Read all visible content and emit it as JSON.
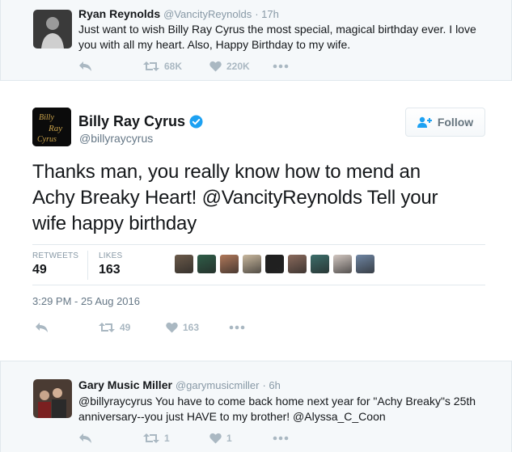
{
  "reply_context": {
    "name": "Ryan Reynolds",
    "handle": "@VancityReynolds",
    "time": "· 17h",
    "text_line1": "Just want to wish Billy Ray Cyrus the most special, magical birthday ever. I love",
    "text_line2": "you with all my heart. Also, Happy Birthday to my wife.",
    "retweets": "68K",
    "likes": "220K"
  },
  "main_tweet": {
    "name": "Billy Ray Cyrus",
    "handle": "@billyraycyrus",
    "avatar_text": [
      "Billy",
      "Ray",
      "Cyrus"
    ],
    "follow_label": "Follow",
    "text_line1": "Thanks man, you really know how to mend an",
    "text_line2": "Achy Breaky Heart! @VancityReynolds Tell your",
    "text_line3": "wife happy birthday",
    "retweets_label": "RETWEETS",
    "retweets_value": "49",
    "likes_label": "LIKES",
    "likes_value": "163",
    "timestamp": "3:29 PM - 25 Aug 2016",
    "action_retweets": "49",
    "action_likes": "163"
  },
  "reply": {
    "name": "Gary Music Miller",
    "handle": "@garymusicmiller",
    "time": "· 6h",
    "text_line1": "@billyraycyrus You have to come back home next year for \"Achy Breaky\"s 25th",
    "text_line2": "anniversary--you just HAVE to my brother! @Alyssa_C_Coon",
    "retweets": "1",
    "likes": "1"
  },
  "liker_colors": [
    "#6b5a4a",
    "#2f5d48",
    "#b0785a",
    "#c9b89e",
    "#1f1f1f",
    "#8a6a5c",
    "#3c6e6a",
    "#d2c7c1",
    "#6f86a3"
  ],
  "colors": {
    "verified": "#1da1f2",
    "icon": "#aab8c2",
    "follow_icon": "#1da1f2"
  }
}
